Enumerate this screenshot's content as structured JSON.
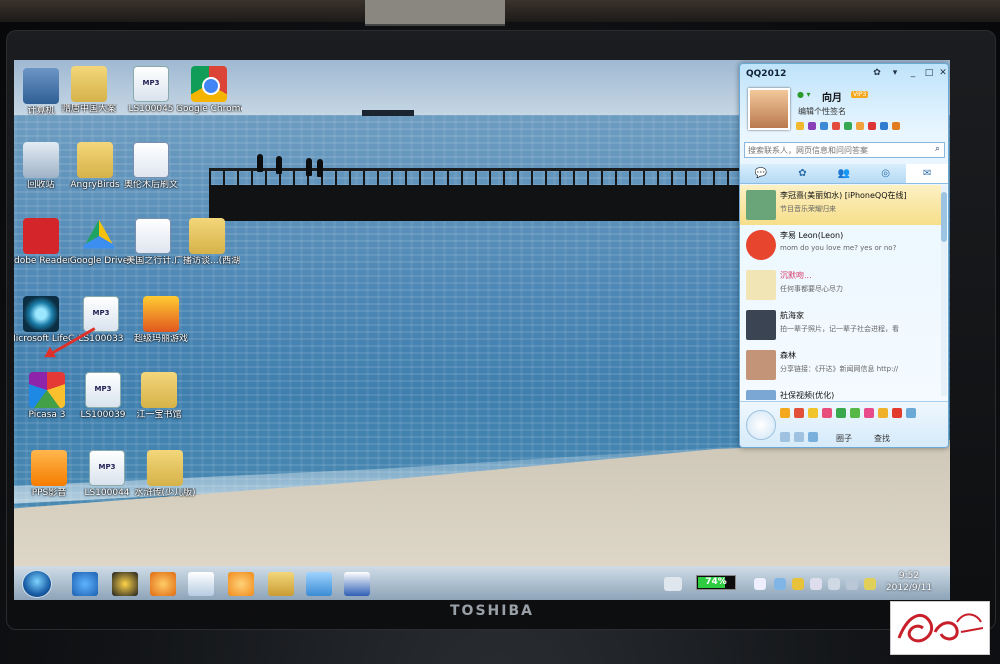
{
  "monitor": {
    "brand": "TOSHIBA"
  },
  "desktop": {
    "icons": [
      {
        "label": "计算机",
        "icon": "computer-icon"
      },
      {
        "label": "隋唐中国大案",
        "icon": "folder-icon"
      },
      {
        "label": "LS100045",
        "icon": "mp3-file-icon"
      },
      {
        "label": "Google Chrome 浏...",
        "icon": "chrome-icon"
      },
      {
        "label": "回收站",
        "icon": "recycle-bin-icon"
      },
      {
        "label": "AngryBirds",
        "icon": "folder-icon"
      },
      {
        "label": "奥伦木后刷文",
        "icon": "document-icon"
      },
      {
        "label": "Adobe Reader X",
        "icon": "adobe-reader-icon"
      },
      {
        "label": "Google Drive",
        "icon": "google-drive-icon"
      },
      {
        "label": "美国之行计...",
        "icon": "document-icon"
      },
      {
        "label": "广播访谈...(西湖...)",
        "icon": "folder-icon"
      },
      {
        "label": "Microsoft LifeCam",
        "icon": "lifecam-icon"
      },
      {
        "label": "LS100033",
        "icon": "mp3-file-icon"
      },
      {
        "label": "超级玛丽游戏",
        "icon": "game-icon"
      },
      {
        "label": "Picasa 3",
        "icon": "picasa-icon"
      },
      {
        "label": "LS100039",
        "icon": "mp3-file-icon"
      },
      {
        "label": "江一宝书馆",
        "icon": "folder-icon"
      },
      {
        "label": "PPS影音",
        "icon": "pps-icon"
      },
      {
        "label": "LS100044",
        "icon": "mp3-file-icon"
      },
      {
        "label": "水浒传(少儿版)",
        "icon": "folder-icon"
      }
    ],
    "mp3_tag": "MP3"
  },
  "qq": {
    "title": "QQ2012",
    "nickname": "向月",
    "vip_badge": "VIP3",
    "signature": "编辑个性签名",
    "search_placeholder": "搜索联系人，网页信息和问问答案",
    "tabs": [
      "💬",
      "✿",
      "👥",
      "◎",
      "✉"
    ],
    "contacts": [
      {
        "name": "李冠熹(美丽如水)  [iPhoneQQ在线]",
        "message": "节目音乐荣耀归来",
        "avatar_color": "#6aa57a"
      },
      {
        "name": "李易 Leon(Leon)",
        "message": "mom do you love me? yes or no?",
        "avatar_color": "#e8452f"
      },
      {
        "name": "沉默吻...",
        "message": "任何事都要尽心尽力",
        "avatar_color": "#f2e5b5"
      },
      {
        "name": "航海家",
        "message": "拍一辈子照片，记一辈子社会进程，看",
        "avatar_color": "#3b4452"
      },
      {
        "name": "森林",
        "message": "分享链接：《开达》新闻网信息 http://",
        "avatar_color": "#c49478"
      },
      {
        "name": "社保视频(优化)",
        "message": "",
        "avatar_color": "#7aa7d4"
      }
    ],
    "plaza_label": "圈子",
    "find_label": "查找"
  },
  "taskbar": {
    "battery_percent": 74,
    "battery_label": "74%",
    "time": "9:52",
    "date": "2012/9/11"
  }
}
